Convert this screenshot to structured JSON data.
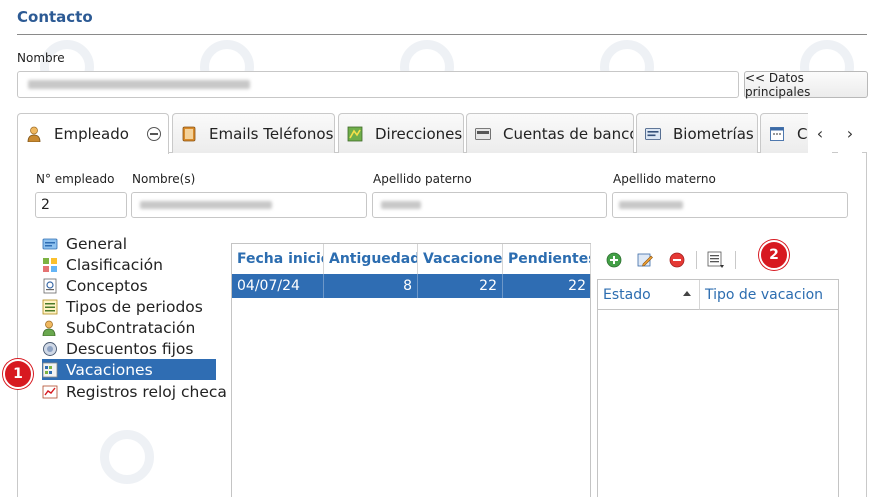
{
  "page": {
    "section_title": "Contacto"
  },
  "contact": {
    "nombre_label": "Nombre",
    "datos_principales_button": "<< Datos principales"
  },
  "tabs": [
    {
      "label": "Empleado",
      "icon": "person-icon"
    },
    {
      "label": "Emails Teléfonos",
      "icon": "address-book-icon"
    },
    {
      "label": "Direcciones",
      "icon": "map-icon"
    },
    {
      "label": "Cuentas de banco",
      "icon": "bank-card-icon"
    },
    {
      "label": "Biometrías",
      "icon": "id-card-icon"
    },
    {
      "label": "C",
      "icon": "calendar-icon"
    }
  ],
  "employee": {
    "numero_label": "N° empleado",
    "numero_value": "2",
    "nombres_label": "Nombre(s)",
    "apellido_paterno_label": "Apellido paterno",
    "apellido_materno_label": "Apellido materno"
  },
  "tree": [
    {
      "label": "General",
      "icon": "general-icon"
    },
    {
      "label": "Clasificación",
      "icon": "classification-icon"
    },
    {
      "label": "Conceptos",
      "icon": "concepts-icon"
    },
    {
      "label": "Tipos de periodos",
      "icon": "periods-icon"
    },
    {
      "label": "SubContratación",
      "icon": "person-icon"
    },
    {
      "label": "Descuentos fijos",
      "icon": "discount-icon"
    },
    {
      "label": "Vacaciones",
      "icon": "vacation-icon"
    },
    {
      "label": "Registros reloj checa",
      "icon": "clock-record-icon"
    }
  ],
  "vacation_grid": {
    "columns": [
      "Fecha inicio",
      "Antiguedad",
      "Vacaciones",
      "Pendientes"
    ],
    "rows": [
      {
        "fecha": "04/07/24",
        "antiguedad": "8",
        "vacaciones": "22",
        "pendientes": "22"
      }
    ]
  },
  "detail_grid": {
    "columns": [
      "Estado",
      "Tipo de vacacion"
    ]
  },
  "callouts": {
    "one": "1",
    "two": "2"
  },
  "colors": {
    "accent": "#2f6db3",
    "title": "#2c5a94",
    "callout": "#d71920"
  }
}
